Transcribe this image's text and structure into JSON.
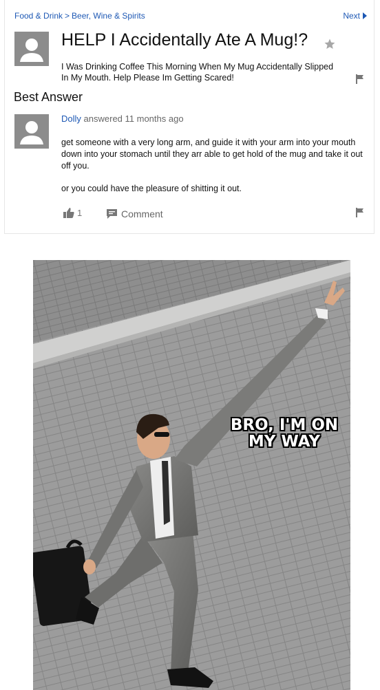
{
  "breadcrumb": {
    "category": "Food & Drink",
    "separator": ">",
    "subcategory": "Beer, Wine & Spirits"
  },
  "nav": {
    "next_label": "Next"
  },
  "question": {
    "title": "HELP I Accidentally Ate A Mug!?",
    "body": "I Was Drinking Coffee This Morning When My Mug Accidentally Slipped In My Mouth. Help Please Im Getting Scared!"
  },
  "best_answer": {
    "heading": "Best Answer",
    "user": "Dolly",
    "meta": "answered 11 months ago",
    "paragraphs": [
      "get someone with a very long arm, and guide it with your arm into your mouth down into your stomach until they arr able to get hold of the mug and take it out off you.",
      "or you could have the pleasure of shitting it out."
    ],
    "thumbs_up_count": "1",
    "comment_label": "Comment"
  },
  "meme": {
    "caption": "BRO, I'M ON MY WAY"
  },
  "colors": {
    "link": "#1d58b4",
    "avatar_bg": "#8c8c8c"
  }
}
